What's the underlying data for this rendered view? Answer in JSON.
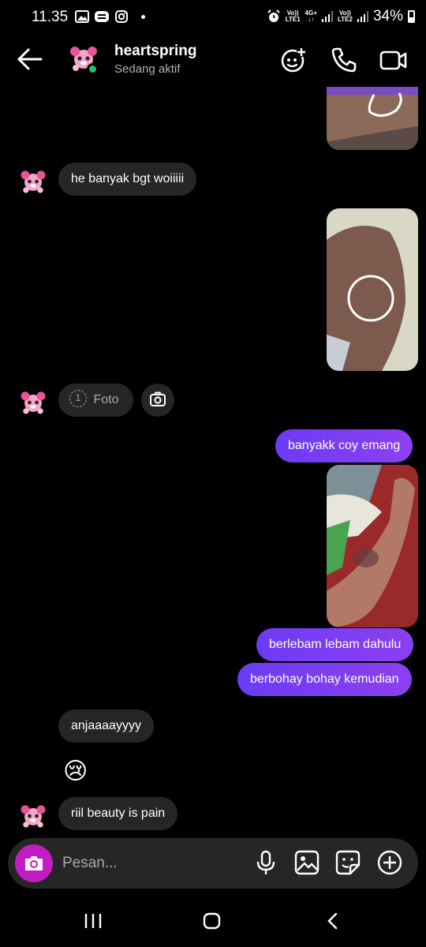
{
  "status_bar": {
    "time": "11.35",
    "sim1": {
      "top": "Vo))",
      "bottom": "LTE1"
    },
    "sim2": {
      "top": "Vo))",
      "bottom": "LTE2"
    },
    "network": "4G+",
    "battery": "34%"
  },
  "header": {
    "name": "heartspring",
    "status": "Sedang aktif"
  },
  "messages": {
    "msg1": "he banyak bgt woiiiii",
    "view_once_count": "1",
    "view_once_label": "Foto",
    "msg2": "banyakk coy emang",
    "msg3": "berlebam lebam dahulu",
    "msg4": "berbohay bohay kemudian",
    "msg5": "anjaaaayyyy",
    "msg6": "😢",
    "msg7": "riil beauty is pain"
  },
  "composer": {
    "placeholder": "Pesan..."
  },
  "colors": {
    "outgoing_bubble": "#7c3ef2",
    "incoming_bubble": "#262626",
    "camera_button": "#c31cc3",
    "online": "#1dc26b"
  }
}
